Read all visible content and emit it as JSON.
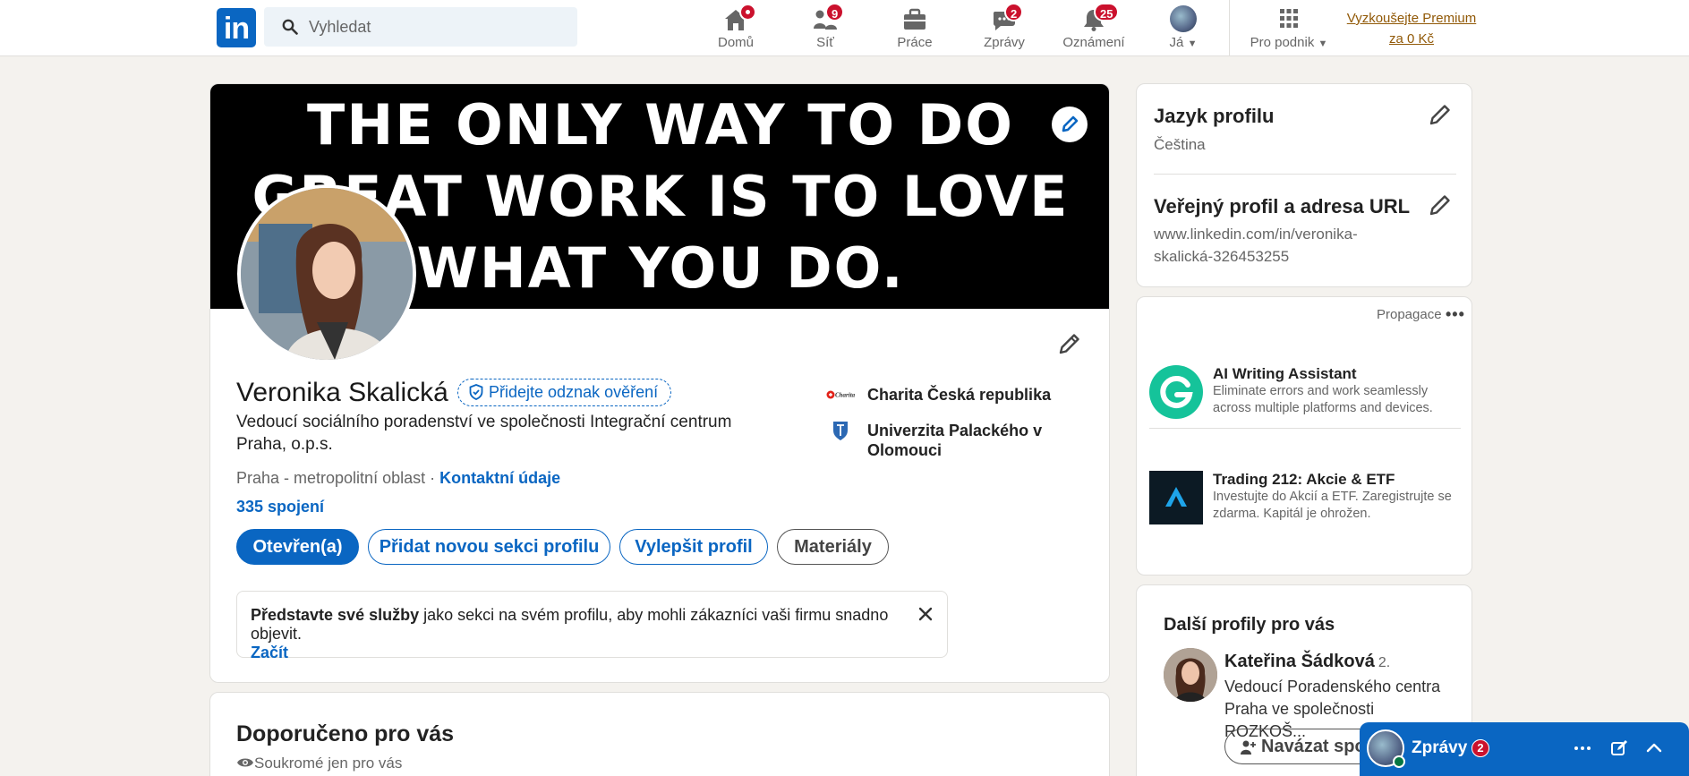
{
  "nav": {
    "logo": "in",
    "search_placeholder": "Vyhledat",
    "items": [
      {
        "label": "Domů",
        "icon": "home-icon",
        "badge": ""
      },
      {
        "label": "Síť",
        "icon": "network-icon",
        "badge": "9"
      },
      {
        "label": "Práce",
        "icon": "briefcase-icon",
        "badge": ""
      },
      {
        "label": "Zprávy",
        "icon": "messaging-icon",
        "badge": "2"
      },
      {
        "label": "Oznámení",
        "icon": "bell-icon",
        "badge": "25"
      },
      {
        "label": "Já",
        "icon": "avatar-icon",
        "badge": ""
      },
      {
        "label": "Pro podnik",
        "icon": "grid-icon",
        "badge": ""
      }
    ],
    "premium_line1": "Vyzkoušejte Premium",
    "premium_line2": "za 0 Kč"
  },
  "profile": {
    "banner_line1": "THE ONLY WAY TO DO",
    "banner_line2": "GREAT WORK IS TO LOVE",
    "banner_line3": "WHAT YOU DO.",
    "name": "Veronika Skalická",
    "verify_badge": "Přidejte odznak ověření",
    "headline": "Vedoucí sociálního poradenství ve společnosti Integrační centrum Praha, o.p.s.",
    "location": "Praha - metropolitní oblast · ",
    "contact_link": "Kontaktní údaje",
    "connections": "335 spojení",
    "buttons": {
      "open": "Otevřen(a)",
      "add_section": "Přidat novou sekci profilu",
      "improve": "Vylepšit profil",
      "resources": "Materiály"
    },
    "orgs": [
      {
        "name": "Charita Česká republika",
        "logo_text": "Charita"
      },
      {
        "name": "Univerzita Palackého v Olomouci",
        "logo_text": ""
      }
    ],
    "notice": {
      "bold": "Představte své služby",
      "text": " jako sekci na svém profilu, aby mohli zákazníci vaši firmu snadno objevit.",
      "link": "Začít"
    }
  },
  "recommended": {
    "title": "Doporučeno pro vás",
    "subtitle": "Soukromé jen pro vás"
  },
  "sidebar": {
    "language_title": "Jazyk profilu",
    "language_value": "Čeština",
    "public_title": "Veřejný profil a adresa URL",
    "public_url_line1": "www.linkedin.com/in/veronika-",
    "public_url_line2": "skalická-326453255"
  },
  "ads": {
    "promo_label": "Propagace",
    "items": [
      {
        "title": "AI Writing Assistant",
        "desc": "Eliminate errors and work seamlessly across multiple platforms and devices."
      },
      {
        "title": "Trading 212: Akcie & ETF",
        "desc": "Investujte do Akcií a ETF. Zaregistrujte se zdarma. Kapitál je ohrožen."
      }
    ]
  },
  "more_profiles": {
    "title": "Další profily pro vás",
    "person": {
      "name": "Kateřina Šádková",
      "degree": "2.",
      "headline": "Vedoucí Poradenského centra Praha ve společnosti ROZKOŠ...",
      "connect": "Navázat spo"
    }
  },
  "messaging": {
    "label": "Zprávy",
    "badge": "2"
  },
  "colors": {
    "brand": "#0a66c2",
    "badge": "#cb112d",
    "premium": "#915907",
    "background": "#f4f2ee"
  }
}
